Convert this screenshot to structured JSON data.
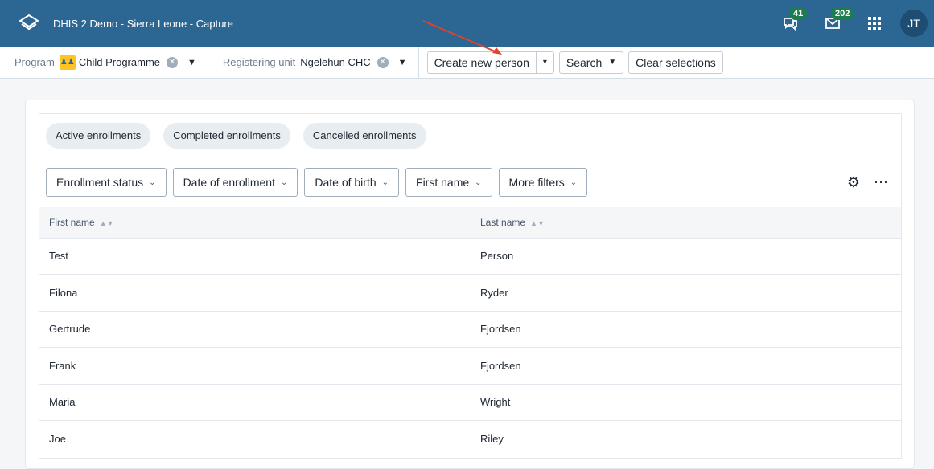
{
  "header": {
    "title": "DHIS 2 Demo - Sierra Leone - Capture",
    "interpretations_count": "41",
    "messages_count": "202",
    "user_initials": "JT"
  },
  "context": {
    "program_label": "Program",
    "program_value": "Child Programme",
    "org_label": "Registering unit",
    "org_value": "Ngelehun CHC",
    "create_button": "Create new person",
    "search_button": "Search",
    "clear_button": "Clear selections"
  },
  "chips": [
    "Active enrollments",
    "Completed enrollments",
    "Cancelled enrollments"
  ],
  "filters": [
    "Enrollment status",
    "Date of enrollment",
    "Date of birth",
    "First name",
    "More filters"
  ],
  "table": {
    "columns": [
      "First name",
      "Last name"
    ],
    "rows": [
      [
        "Test",
        "Person"
      ],
      [
        "Filona",
        "Ryder"
      ],
      [
        "Gertrude",
        "Fjordsen"
      ],
      [
        "Frank",
        "Fjordsen"
      ],
      [
        "Maria",
        "Wright"
      ],
      [
        "Joe",
        "Riley"
      ]
    ]
  },
  "colors": {
    "header": "#2c6693",
    "badge": "#1e7d4f",
    "program_icon": "#ffc324",
    "annotation_arrow": "#e0422e"
  }
}
